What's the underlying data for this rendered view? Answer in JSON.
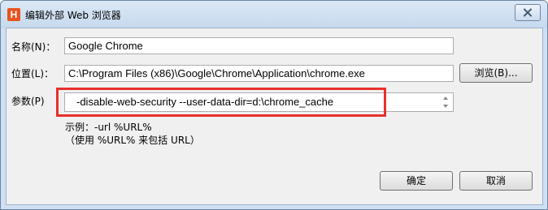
{
  "dialog": {
    "title": "编辑外部 Web 浏览器",
    "icon_letter": "H",
    "name_label": "名称(N)：",
    "name_value": "Google Chrome",
    "location_label": "位置(L)：",
    "location_value": "C:\\Program Files (x86)\\Google\\Chrome\\Application\\chrome.exe",
    "browse_label": "浏览(B)...",
    "params_label": "参数(P)",
    "params_value": "-disable-web-security --user-data-dir=d:\\chrome_cache",
    "hint_line1": "示例：-url %URL%",
    "hint_line2": "（使用 %URL% 来包括 URL）",
    "ok_label": "确定",
    "cancel_label": "取消"
  },
  "colors": {
    "highlight": "#e8302b",
    "icon": "#e8531f"
  }
}
